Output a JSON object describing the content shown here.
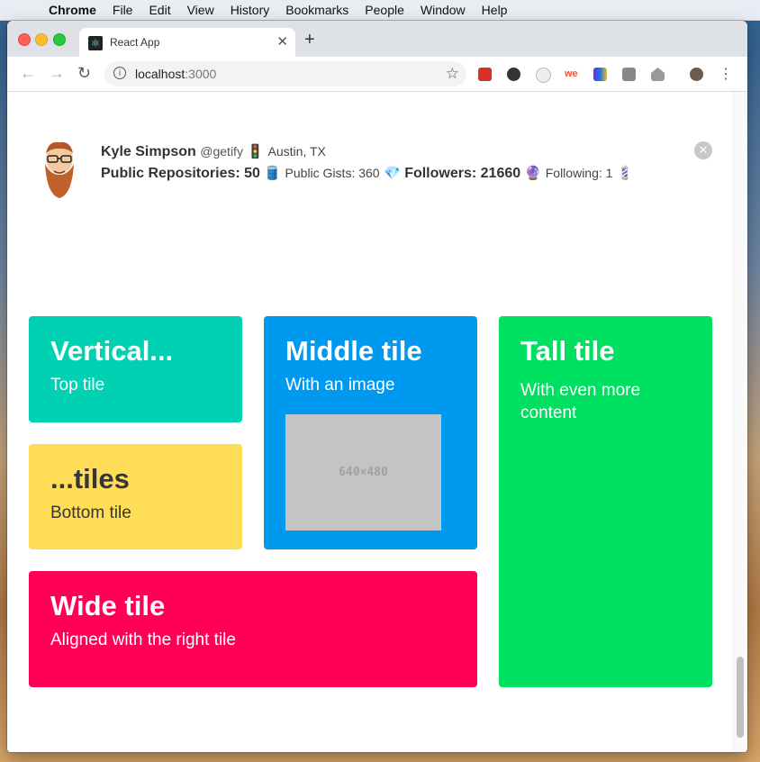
{
  "menubar": {
    "app_name": "Chrome",
    "items": [
      "File",
      "Edit",
      "View",
      "History",
      "Bookmarks",
      "People",
      "Window",
      "Help"
    ]
  },
  "browser": {
    "tab_title": "React App",
    "tab_close": "✕",
    "new_tab": "+",
    "url_host": "localhost",
    "url_port": ":3000"
  },
  "profile": {
    "name": "Kyle Simpson",
    "handle": "@getify",
    "location_emoji": "🚦",
    "location": "Austin, TX",
    "repos_label": "Public Repositories: 50",
    "repos_emoji": "🛢️",
    "gists_label": "Public Gists: 360",
    "gists_emoji": "💎",
    "followers_label": "Followers: 21660",
    "followers_emoji": "🔮",
    "following_label": "Following: 1",
    "following_emoji": "💈",
    "dismiss": "✕"
  },
  "tiles": {
    "vertical": {
      "title": "Vertical...",
      "subtitle": "Top tile",
      "color": "#00d1b2"
    },
    "tiles": {
      "title": "...tiles",
      "subtitle": "Bottom tile",
      "color": "#ffdd57"
    },
    "middle": {
      "title": "Middle tile",
      "subtitle": "With an image",
      "image_text": "640×480",
      "color": "#0099f0"
    },
    "tall": {
      "title": "Tall tile",
      "subtitle": "With even more content",
      "color": "#00e060"
    },
    "wide": {
      "title": "Wide tile",
      "subtitle": "Aligned with the right tile",
      "color": "#ff0055"
    }
  }
}
